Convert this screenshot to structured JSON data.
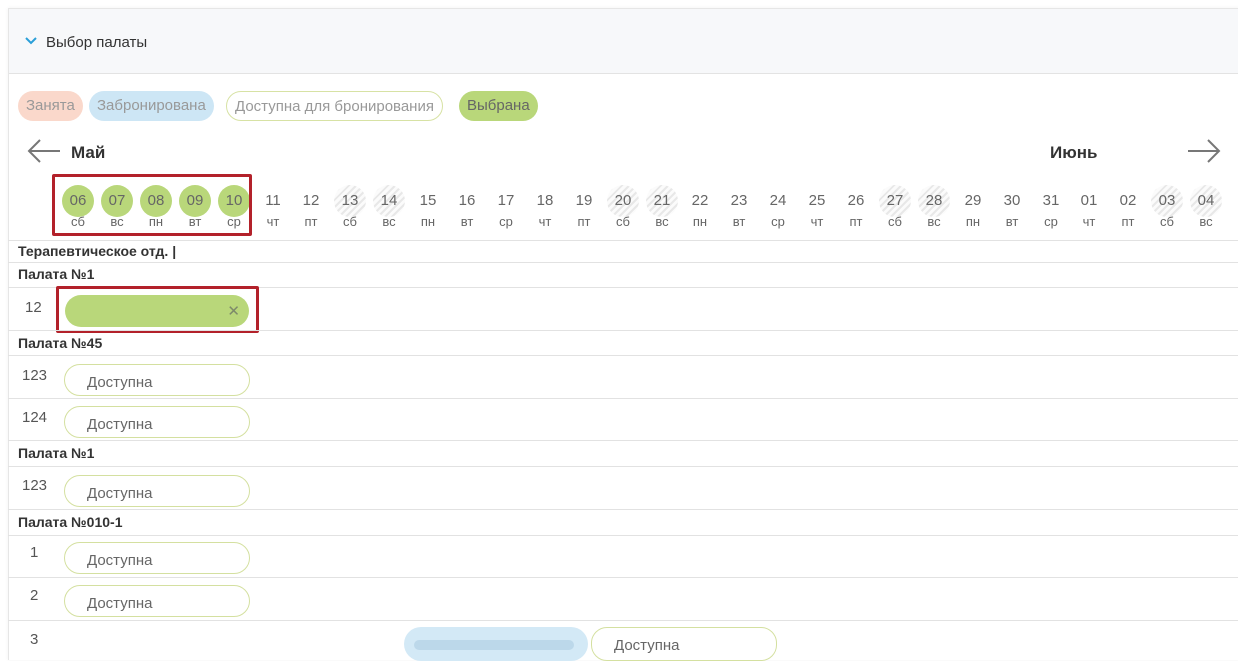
{
  "header": {
    "title": "Выбор палаты"
  },
  "legend": {
    "busy": "Занята",
    "booked": "Забронирована",
    "available": "Доступна для бронирования",
    "chosen": "Выбрана"
  },
  "months": {
    "left": "Май",
    "right": "Июнь"
  },
  "days": [
    {
      "num": "06",
      "wd": "сб",
      "state": "selected"
    },
    {
      "num": "07",
      "wd": "вс",
      "state": "selected"
    },
    {
      "num": "08",
      "wd": "пн",
      "state": "selected"
    },
    {
      "num": "09",
      "wd": "вт",
      "state": "selected"
    },
    {
      "num": "10",
      "wd": "ср",
      "state": "selected"
    },
    {
      "num": "11",
      "wd": "чт",
      "state": "normal"
    },
    {
      "num": "12",
      "wd": "пт",
      "state": "normal"
    },
    {
      "num": "13",
      "wd": "сб",
      "state": "weekend"
    },
    {
      "num": "14",
      "wd": "вс",
      "state": "weekend"
    },
    {
      "num": "15",
      "wd": "пн",
      "state": "normal"
    },
    {
      "num": "16",
      "wd": "вт",
      "state": "normal"
    },
    {
      "num": "17",
      "wd": "ср",
      "state": "normal"
    },
    {
      "num": "18",
      "wd": "чт",
      "state": "normal"
    },
    {
      "num": "19",
      "wd": "пт",
      "state": "normal"
    },
    {
      "num": "20",
      "wd": "сб",
      "state": "weekend"
    },
    {
      "num": "21",
      "wd": "вс",
      "state": "weekend"
    },
    {
      "num": "22",
      "wd": "пн",
      "state": "normal"
    },
    {
      "num": "23",
      "wd": "вт",
      "state": "normal"
    },
    {
      "num": "24",
      "wd": "ср",
      "state": "normal"
    },
    {
      "num": "25",
      "wd": "чт",
      "state": "normal"
    },
    {
      "num": "26",
      "wd": "пт",
      "state": "normal"
    },
    {
      "num": "27",
      "wd": "сб",
      "state": "weekend"
    },
    {
      "num": "28",
      "wd": "вс",
      "state": "weekend"
    },
    {
      "num": "29",
      "wd": "пн",
      "state": "normal"
    },
    {
      "num": "30",
      "wd": "вт",
      "state": "normal"
    },
    {
      "num": "31",
      "wd": "ср",
      "state": "normal"
    },
    {
      "num": "01",
      "wd": "чт",
      "state": "normal"
    },
    {
      "num": "02",
      "wd": "пт",
      "state": "normal"
    },
    {
      "num": "03",
      "wd": "сб",
      "state": "weekend"
    },
    {
      "num": "04",
      "wd": "вс",
      "state": "weekend"
    }
  ],
  "department": "Терапевтическое отд. |",
  "wards": [
    {
      "name": "Палата №1"
    },
    {
      "name": "Палата №45"
    },
    {
      "name": "Палата №1"
    },
    {
      "name": "Палата №010-1"
    }
  ],
  "beds": {
    "w1_b1": "12",
    "w2_b1": "123",
    "w2_b2": "124",
    "w3_b1": "123",
    "w4_b1": "1",
    "w4_b2": "2",
    "w4_b3": "3"
  },
  "available_label": "Доступна",
  "chosen_remove_icon": "close-icon",
  "colors": {
    "busy": "#fad8cb",
    "booked": "#cde6f5",
    "chosen": "#b9d77a",
    "highlight": "#b3212a"
  }
}
